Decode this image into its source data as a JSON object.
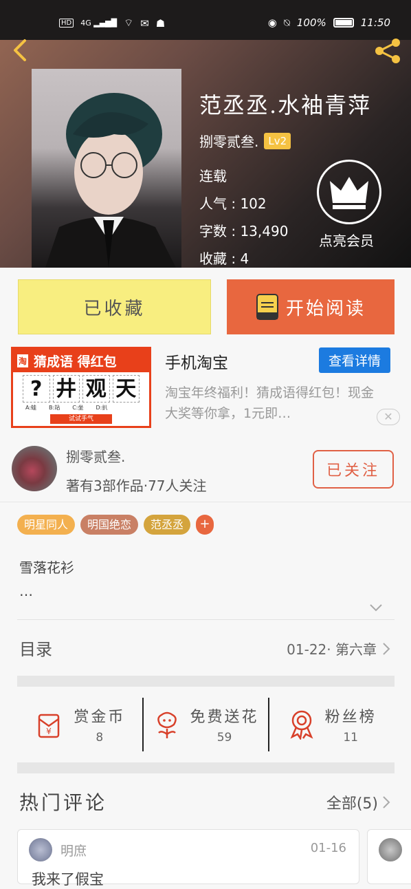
{
  "statusbar": {
    "left": [
      "HD",
      "4G"
    ],
    "battery": "100%",
    "time": "11:50"
  },
  "book": {
    "title": "范丞丞.水袖青萍",
    "author": "捌零贰叁.",
    "level": "Lv2",
    "status": "连载",
    "popularity": "人气 : 102",
    "word_count": "字数 : 13,490",
    "collections": "收藏 : 4",
    "vip_label": "点亮会员"
  },
  "actions": {
    "favorited": "已收藏",
    "read": "开始阅读"
  },
  "ad": {
    "banner_brand": "淘",
    "banner_title": "猜成语 得红包",
    "banner_chars": [
      "?",
      "井",
      "观",
      "天"
    ],
    "banner_options": [
      "A:蛙",
      "B:站",
      "C:坐",
      "D:扒"
    ],
    "banner_button": "试试手气",
    "title": "手机淘宝",
    "detail_button": "查看详情",
    "description": "淘宝年终福利！猜成语得红包！现金大奖等你拿，1元即…",
    "close": "✕"
  },
  "author_card": {
    "name": "捌零贰叁.",
    "stats": "著有3部作品·77人关注",
    "follow": "已关注"
  },
  "tags": [
    {
      "label": "明星同人",
      "color": "#f3b04f"
    },
    {
      "label": "明国绝恋",
      "color": "#c98065"
    },
    {
      "label": "范丞丞",
      "color": "#d4a43d"
    }
  ],
  "tag_more": "+",
  "intro": {
    "line1": "雪落花衫",
    "line2": "…"
  },
  "toc": {
    "label": "目录",
    "latest": "01-22· 第六章"
  },
  "rewards": [
    {
      "label": "赏金币",
      "count": "8",
      "icon": "red-envelope-icon"
    },
    {
      "label": "免费送花",
      "count": "59",
      "icon": "flower-icon"
    },
    {
      "label": "粉丝榜",
      "count": "11",
      "icon": "medal-icon"
    }
  ],
  "comments": {
    "heading": "热门评论",
    "all": "全部(5)",
    "items": [
      {
        "user": "明庶",
        "date": "01-16",
        "text": "我来了假宝"
      }
    ]
  }
}
